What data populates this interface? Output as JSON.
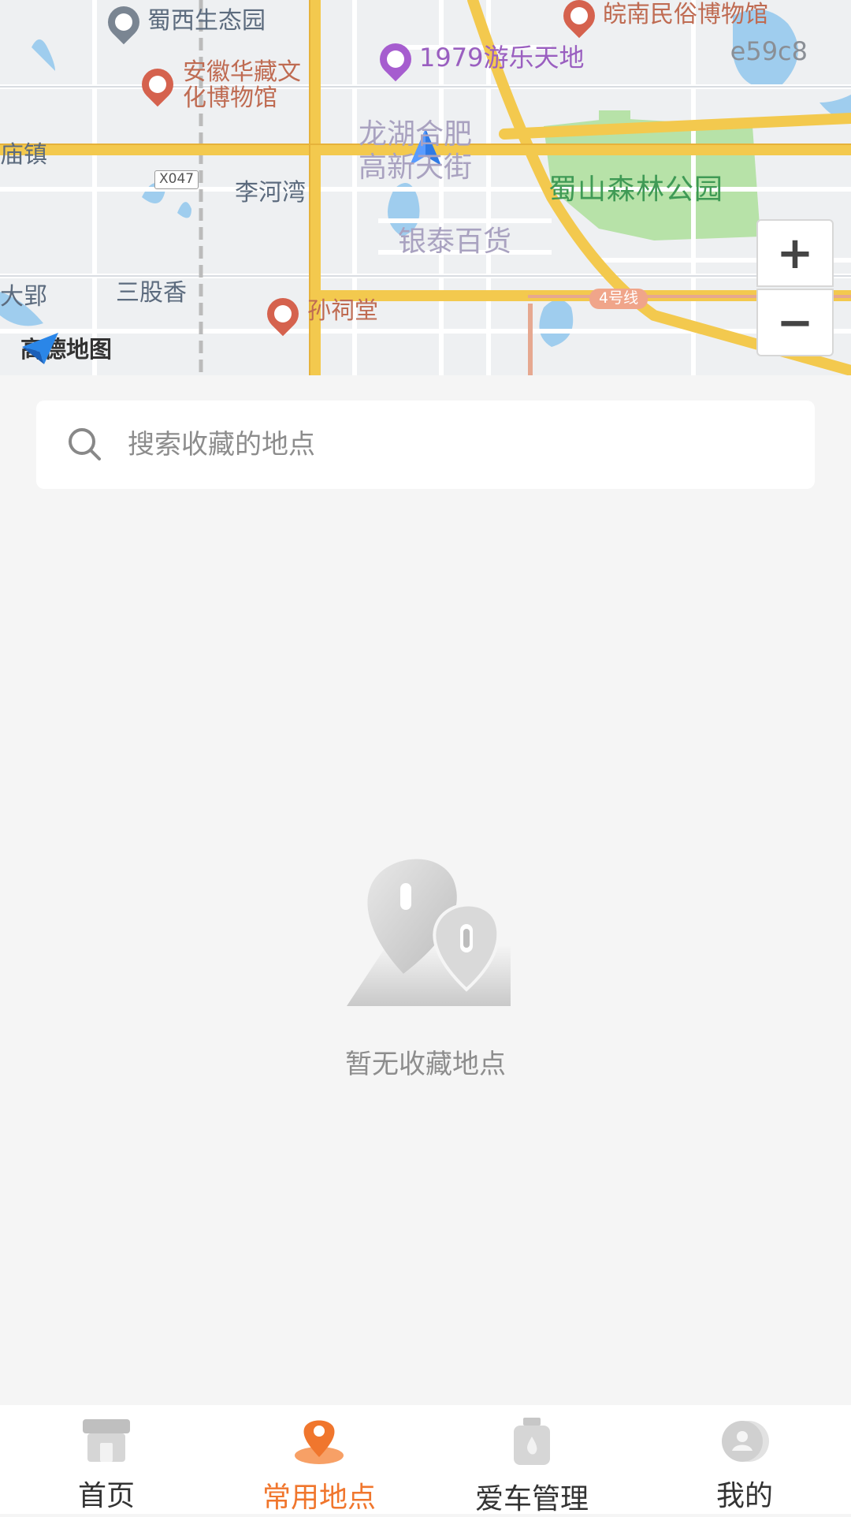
{
  "map": {
    "labels": {
      "shuxi": "蜀西生态园",
      "wannan": "皖南民俗博物馆",
      "leyuan": "1979游乐天地",
      "anhui_line1": "安徽华藏文",
      "anhui_line2": "化博物馆",
      "longhu_line1": "龙湖合肥",
      "longhu_line2": "高新天街",
      "zhen": "庙镇",
      "x047": "X047",
      "lihewan": "李河湾",
      "shushan": "蜀山森林公园",
      "yintai": "银泰百货",
      "daying": "大郢",
      "sangu": "三股香",
      "sunci": "孙祠堂",
      "metro4": "4号线"
    },
    "watermark_code": "e59c8",
    "logo_text": "高德地图",
    "zoom_in": "+",
    "zoom_out": "−"
  },
  "search": {
    "placeholder": "搜索收藏的地点",
    "icon": "search-icon"
  },
  "empty_state": {
    "text": "暂无收藏地点",
    "icon": "location-pins-icon"
  },
  "tabs": [
    {
      "label": "首页",
      "icon": "home-icon",
      "active": false
    },
    {
      "label": "常用地点",
      "icon": "location-pin-icon",
      "active": true
    },
    {
      "label": "爱车管理",
      "icon": "car-fluid-icon",
      "active": false
    },
    {
      "label": "我的",
      "icon": "profile-icon",
      "active": false
    }
  ],
  "colors": {
    "accent": "#f0762d",
    "road_yellow": "#f3c94e",
    "park_green": "#b7e2a8",
    "water_blue": "#9fcdee"
  }
}
